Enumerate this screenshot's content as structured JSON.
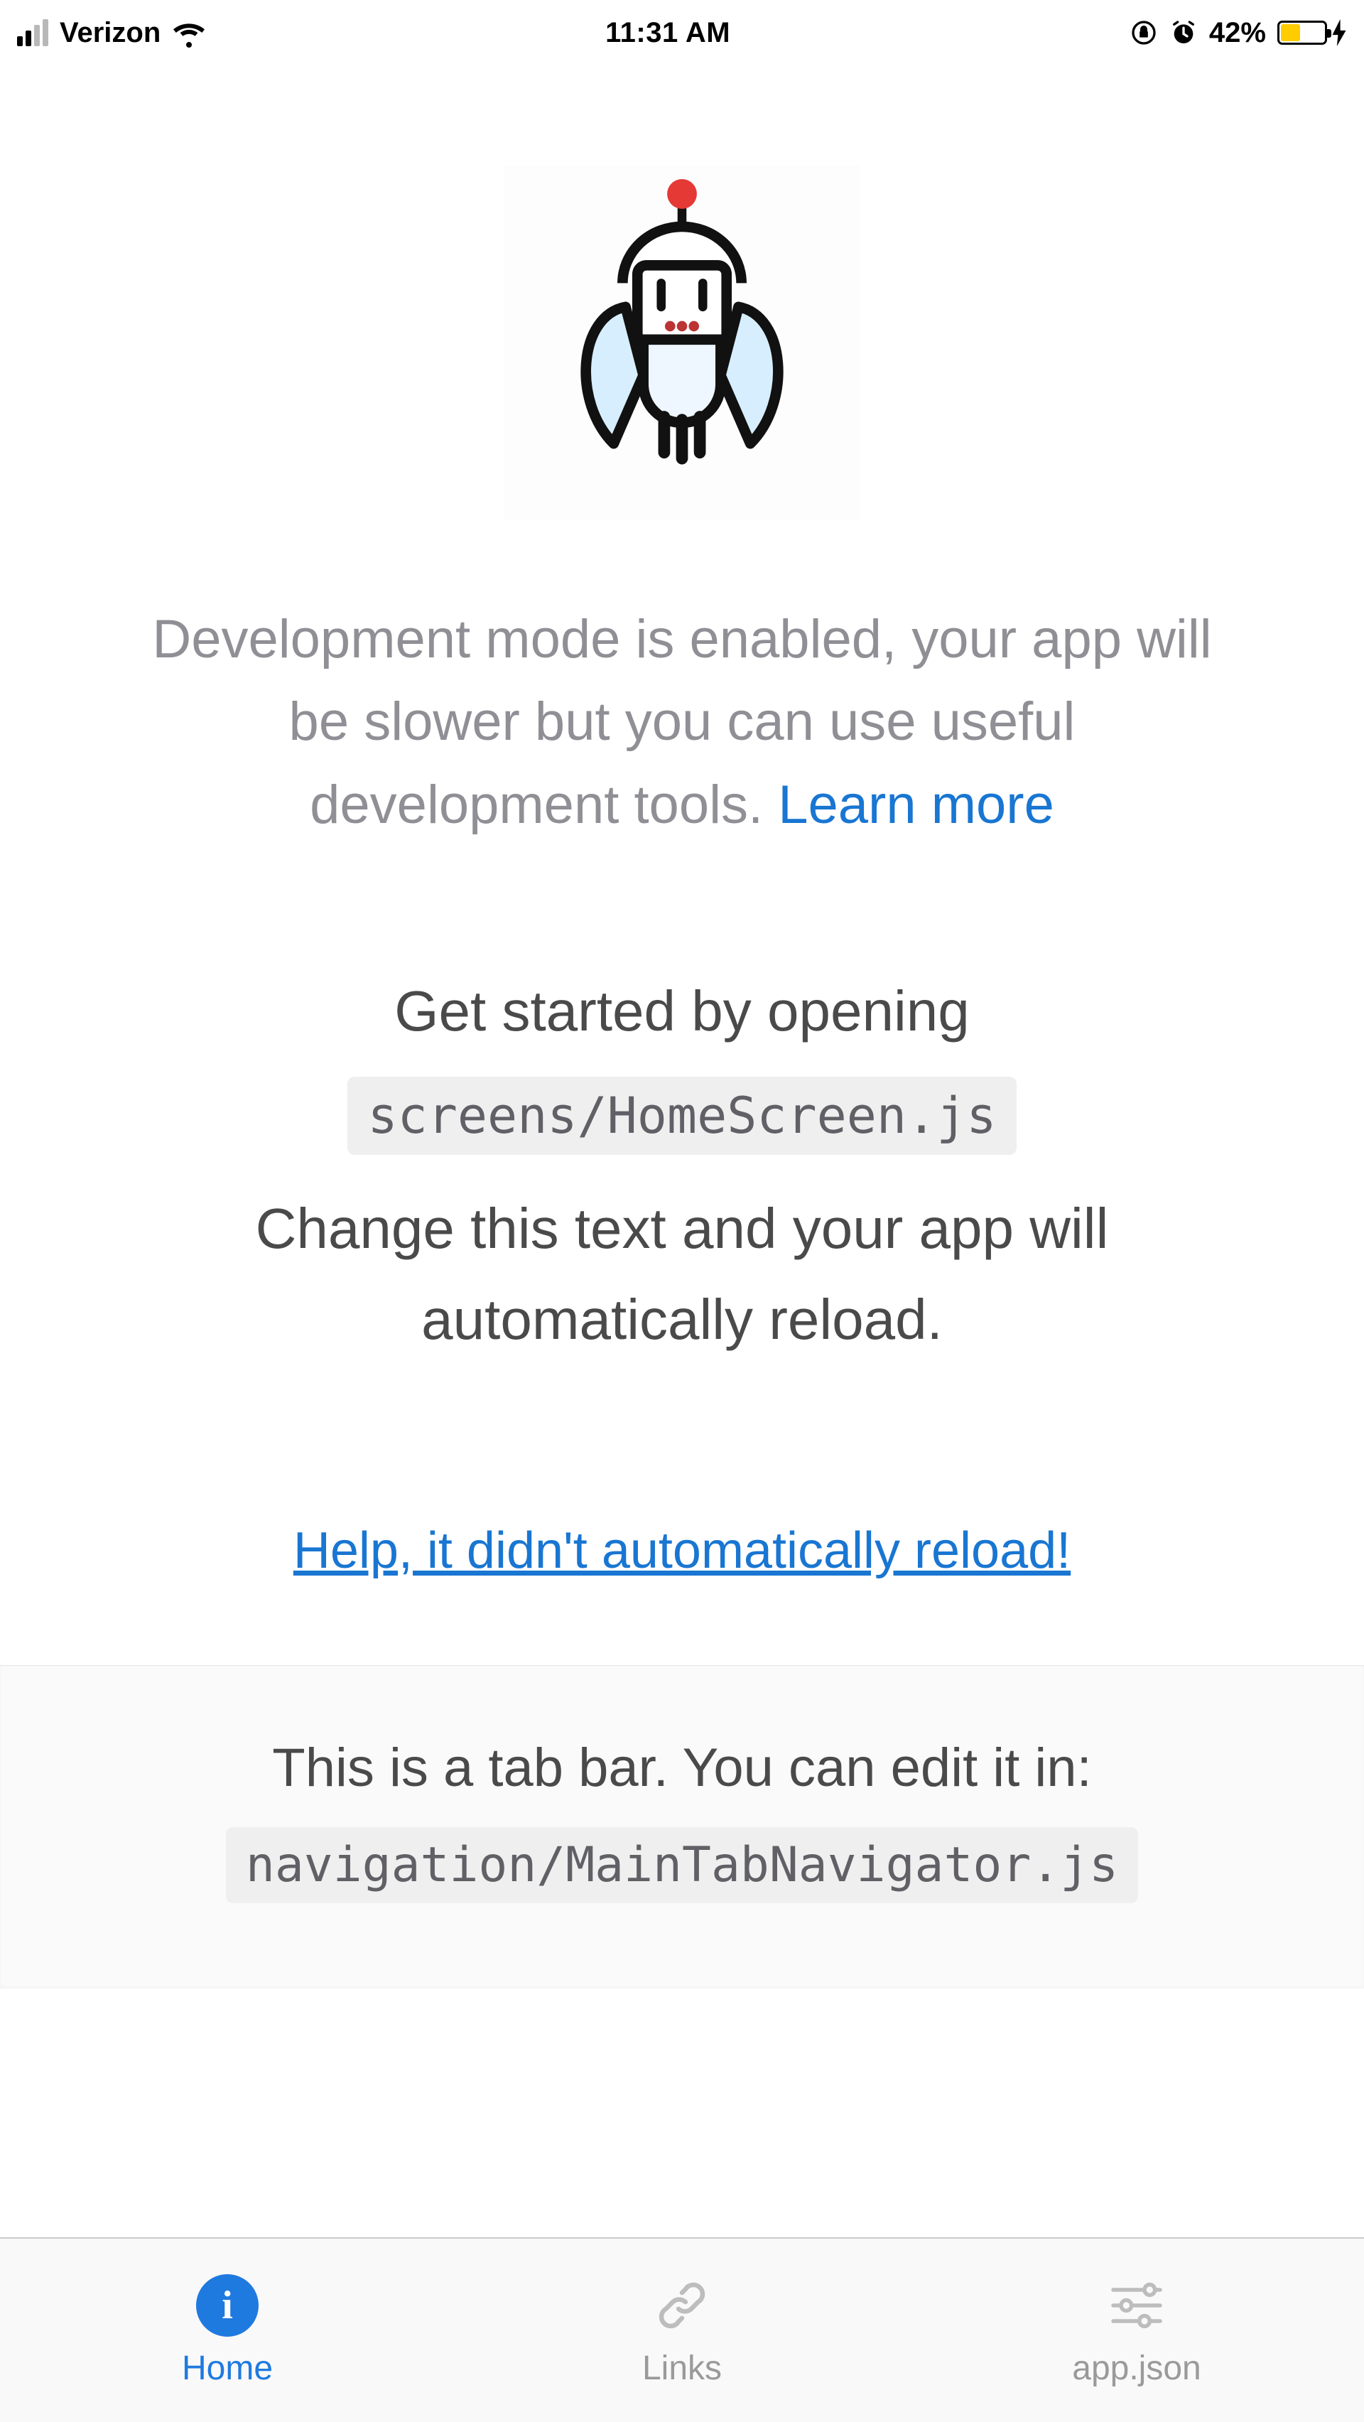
{
  "status_bar": {
    "carrier": "Verizon",
    "time": "11:31 AM",
    "battery_percent": "42%"
  },
  "content": {
    "dev_mode_text": "Development mode is enabled, your app will be slower but you can use useful development tools. ",
    "learn_more": "Learn more",
    "get_started_line": "Get started by opening",
    "home_screen_path": "screens/HomeScreen.js",
    "reload_text": "Change this text and your app will automatically reload.",
    "help_link": "Help, it didn't automatically reload!",
    "tabhint_line": "This is a tab bar. You can edit it in:",
    "tabhint_path": "navigation/MainTabNavigator.js"
  },
  "tabs": {
    "home": "Home",
    "links": "Links",
    "appjson": "app.json"
  }
}
